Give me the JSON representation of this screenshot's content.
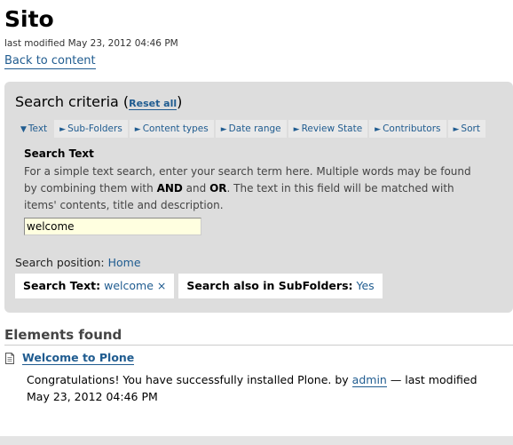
{
  "page": {
    "title": "Sito",
    "modified": "last modified May 23, 2012 04:46 PM",
    "back_link": "Back to content"
  },
  "criteria": {
    "heading": "Search criteria (",
    "reset": "Reset all",
    "heading_close": ")",
    "tabs": [
      {
        "arrow": "▼",
        "label": "Text"
      },
      {
        "arrow": "►",
        "label": "Sub-Folders"
      },
      {
        "arrow": "►",
        "label": "Content types"
      },
      {
        "arrow": "►",
        "label": "Date range"
      },
      {
        "arrow": "►",
        "label": "Review State"
      },
      {
        "arrow": "►",
        "label": "Contributors"
      },
      {
        "arrow": "►",
        "label": "Sort"
      }
    ],
    "text_tab": {
      "label": "Search Text",
      "help_1": "For a simple text search, enter your search term here. Multiple words may be found by combining them with ",
      "and": "AND",
      "help_2": " and ",
      "or": "OR",
      "help_3": ". The text in this field will be matched with items' contents, title and description.",
      "input_value": "welcome"
    },
    "position_label": "Search position: ",
    "position_link": "Home",
    "chips": [
      {
        "key": "Search Text:",
        "value": "welcome",
        "remove": "×"
      },
      {
        "key": "Search also in SubFolders:",
        "value": "Yes"
      }
    ]
  },
  "results": {
    "heading": "Elements found",
    "items": [
      {
        "icon": "document-icon",
        "title": "Welcome to Plone",
        "desc_1": "Congratulations! You have successfully installed Plone. by ",
        "author": "admin",
        "desc_2": " — last modified May 23, 2012 04:46 PM"
      }
    ]
  }
}
